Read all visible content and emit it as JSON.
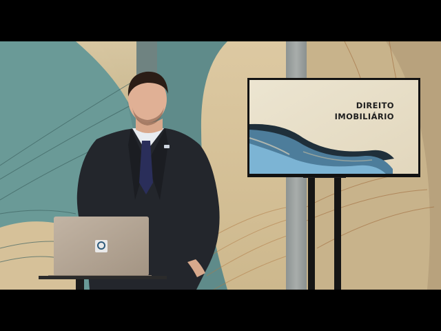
{
  "screen": {
    "title_line1": "DIREITO",
    "title_line2": "IMOBILIÁRIO"
  },
  "icons": {
    "laptop_logo": "circle-logo-icon"
  },
  "colors": {
    "letterbox": "#000000",
    "teal_backdrop": "#5f8e8c",
    "beige_backdrop": "#d8c39a",
    "suit": "#23262c",
    "laptop": "#b3a595",
    "screen_bg": "#ede6d2",
    "wave_blue": "#5f9cc0"
  }
}
